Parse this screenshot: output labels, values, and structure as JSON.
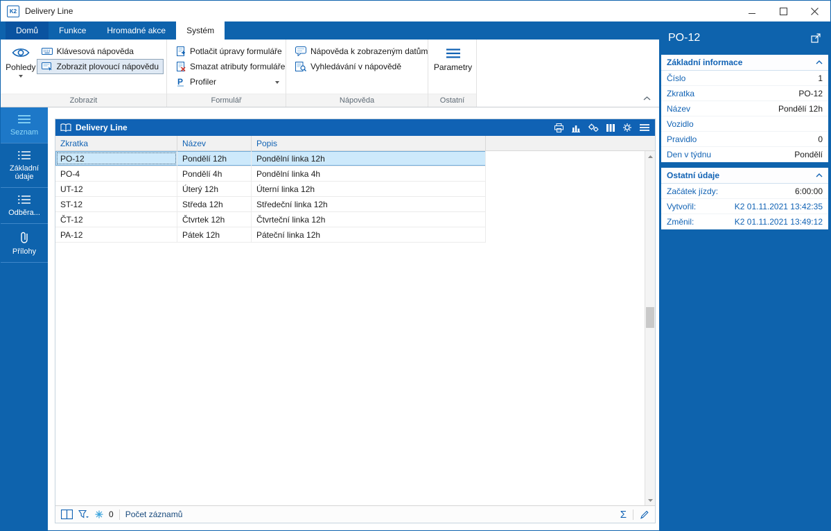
{
  "window": {
    "title": "Delivery Line",
    "app_icon": "K2"
  },
  "colors": {
    "accent": "#0e63ad",
    "panel_header": "#1062b4",
    "selected_row": "#cde9fb",
    "sidebar_selected_text": "#8fd9f9"
  },
  "ribbon": {
    "tabs": {
      "home": "Domů",
      "functions": "Funkce",
      "bulk": "Hromadné akce",
      "system": "Systém"
    },
    "groups": {
      "zobrazit": {
        "label": "Zobrazit",
        "pohledy": "Pohledy",
        "klavesova": "Klávesová nápověda",
        "plovouci": "Zobrazit plovoucí nápovědu"
      },
      "formular": {
        "label": "Formulář",
        "potlacit": "Potlačit úpravy formuláře",
        "smazat": "Smazat atributy formuláře",
        "profiler": "Profiler"
      },
      "napoveda": {
        "label": "Nápověda",
        "data": "Nápověda k zobrazeným datům",
        "vyhledavani": "Vyhledávání v nápovědě"
      },
      "ostatni": {
        "label": "Ostatní",
        "parametry": "Parametry"
      }
    }
  },
  "sidebar": {
    "items": [
      {
        "label": "Seznam",
        "selected": true
      },
      {
        "label": "Základní údaje",
        "selected": false
      },
      {
        "label": "Odběra...",
        "selected": false
      },
      {
        "label": "Přílohy",
        "selected": false
      }
    ]
  },
  "table": {
    "title": "Delivery Line",
    "columns": [
      "Zkratka",
      "Název",
      "Popis"
    ],
    "rows": [
      [
        "PO-12",
        "Pondělí 12h",
        "Pondělní linka 12h"
      ],
      [
        "PO-4",
        "Pondělí 4h",
        "Pondělní linka 4h"
      ],
      [
        "UT-12",
        "Úterý 12h",
        "Úterní linka 12h"
      ],
      [
        "ST-12",
        "Středa 12h",
        "Středeční linka 12h"
      ],
      [
        "ČT-12",
        "Čtvrtek 12h",
        "Čtvrteční linka 12h"
      ],
      [
        "PA-12",
        "Pátek 12h",
        "Páteční linka 12h"
      ]
    ],
    "selected_row": 0,
    "status": {
      "filter_count": "0",
      "records_label": "Počet záznamů"
    }
  },
  "detail": {
    "title": "PO-12",
    "sections": [
      {
        "title": "Základní informace",
        "fields": [
          {
            "label": "Číslo",
            "value": "1"
          },
          {
            "label": "Zkratka",
            "value": "PO-12"
          },
          {
            "label": "Název",
            "value": "Pondělí 12h"
          },
          {
            "label": "Vozidlo",
            "value": ""
          },
          {
            "label": "Pravidlo",
            "value": "0"
          },
          {
            "label": "Den v týdnu",
            "value": "Pondělí"
          }
        ]
      },
      {
        "title": "Ostatní údaje",
        "fields": [
          {
            "label": "Začátek jízdy:",
            "value": "6:00:00"
          },
          {
            "label": "Vytvořil:",
            "value": "K2 01.11.2021 13:42:35"
          },
          {
            "label": "Změnil:",
            "value": "K2 01.11.2021 13:49:12"
          }
        ]
      }
    ]
  }
}
